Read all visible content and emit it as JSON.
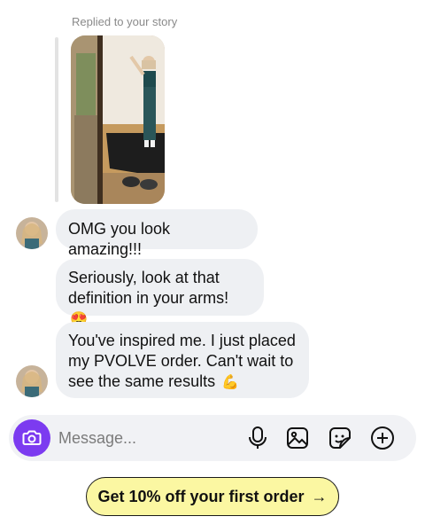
{
  "story": {
    "label": "Replied to your story"
  },
  "messages": [
    {
      "text": "OMG you look amazing!!!",
      "emoji": ""
    },
    {
      "text": "Seriously, look at that definition in your arms!",
      "emoji": "😍"
    },
    {
      "text": "You've inspired me. I just placed my PVOLVE order. Can't wait to see the same results",
      "emoji": "💪"
    }
  ],
  "composer": {
    "placeholder": "Message...",
    "camera_icon": "camera-icon",
    "tools": [
      "microphone-icon",
      "image-icon",
      "sticker-icon",
      "add-icon"
    ]
  },
  "cta": {
    "label": "Get 10% off your first order",
    "arrow": "→"
  },
  "colors": {
    "accent": "#7c3bf0",
    "bubble": "#eef0f3",
    "cta": "#fbf7a2"
  }
}
